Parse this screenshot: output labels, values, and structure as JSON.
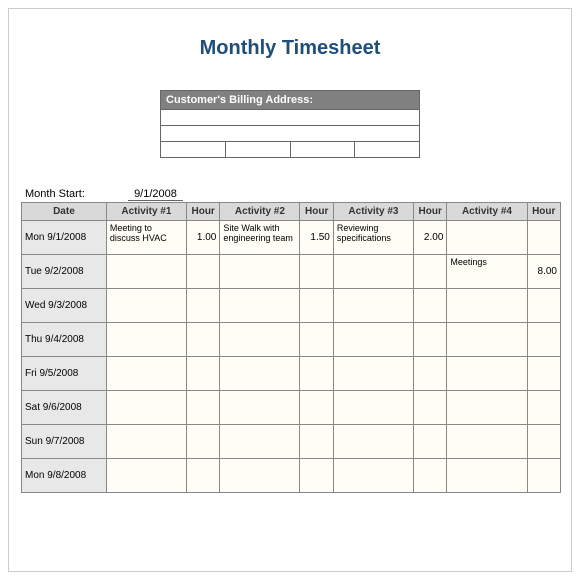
{
  "title": "Monthly Timesheet",
  "billing": {
    "header": "Customer's Billing Address:"
  },
  "monthStart": {
    "label": "Month Start:",
    "value": "9/1/2008"
  },
  "headers": {
    "date": "Date",
    "act1": "Activity #1",
    "h1": "Hour",
    "act2": "Activity #2",
    "h2": "Hour",
    "act3": "Activity #3",
    "h3": "Hour",
    "act4": "Activity #4",
    "h4": "Hour"
  },
  "rows": [
    {
      "date": "Mon 9/1/2008",
      "a1": "Meeting to discuss HVAC",
      "h1": "1.00",
      "a2": "Site Walk with engineering team",
      "h2": "1.50",
      "a3": "Reviewing specifications",
      "h3": "2.00",
      "a4": "",
      "h4": ""
    },
    {
      "date": "Tue 9/2/2008",
      "a1": "",
      "h1": "",
      "a2": "",
      "h2": "",
      "a3": "",
      "h3": "",
      "a4": "Meetings",
      "h4": "8.00"
    },
    {
      "date": "Wed 9/3/2008",
      "a1": "",
      "h1": "",
      "a2": "",
      "h2": "",
      "a3": "",
      "h3": "",
      "a4": "",
      "h4": ""
    },
    {
      "date": "Thu 9/4/2008",
      "a1": "",
      "h1": "",
      "a2": "",
      "h2": "",
      "a3": "",
      "h3": "",
      "a4": "",
      "h4": ""
    },
    {
      "date": "Fri 9/5/2008",
      "a1": "",
      "h1": "",
      "a2": "",
      "h2": "",
      "a3": "",
      "h3": "",
      "a4": "",
      "h4": ""
    },
    {
      "date": "Sat 9/6/2008",
      "a1": "",
      "h1": "",
      "a2": "",
      "h2": "",
      "a3": "",
      "h3": "",
      "a4": "",
      "h4": ""
    },
    {
      "date": "Sun 9/7/2008",
      "a1": "",
      "h1": "",
      "a2": "",
      "h2": "",
      "a3": "",
      "h3": "",
      "a4": "",
      "h4": ""
    },
    {
      "date": "Mon 9/8/2008",
      "a1": "",
      "h1": "",
      "a2": "",
      "h2": "",
      "a3": "",
      "h3": "",
      "a4": "",
      "h4": ""
    }
  ]
}
